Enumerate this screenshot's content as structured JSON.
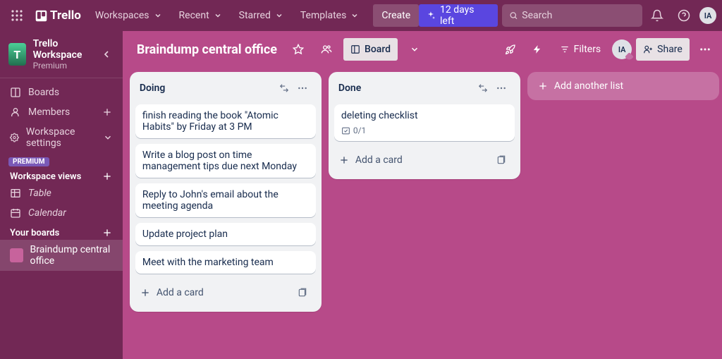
{
  "topbar": {
    "logo_text": "Trello",
    "menus": {
      "workspaces": "Workspaces",
      "recent": "Recent",
      "starred": "Starred",
      "templates": "Templates"
    },
    "create": "Create",
    "days_left": "12 days left",
    "search_placeholder": "Search",
    "avatar_initials": "IA"
  },
  "sidebar": {
    "workspace_initial": "T",
    "workspace_name": "Trello Workspace",
    "workspace_tier": "Premium",
    "items": {
      "boards": "Boards",
      "members": "Members",
      "settings": "Workspace settings"
    },
    "premium_badge": "PREMIUM",
    "views_heading": "Workspace views",
    "views": {
      "table": "Table",
      "calendar": "Calendar"
    },
    "your_boards": "Your boards",
    "board_name": "Braindump central office"
  },
  "board": {
    "title": "Braindump central office",
    "view_label": "Board",
    "filters": "Filters",
    "member_initials": "IA",
    "share": "Share"
  },
  "lists": [
    {
      "title": "Doing",
      "cards": [
        {
          "text": "finish reading the book \"Atomic Habits\" by Friday at 3 PM"
        },
        {
          "text": "Write a blog post on time management tips due next Monday"
        },
        {
          "text": "Reply to John's email about the meeting agenda"
        },
        {
          "text": "Update project plan"
        },
        {
          "text": "Meet with the marketing team"
        }
      ],
      "add_card": "Add a card"
    },
    {
      "title": "Done",
      "cards": [
        {
          "text": "deleting checklist",
          "checklist": "0/1"
        }
      ],
      "add_card": "Add a card"
    }
  ],
  "add_list": "Add another list"
}
